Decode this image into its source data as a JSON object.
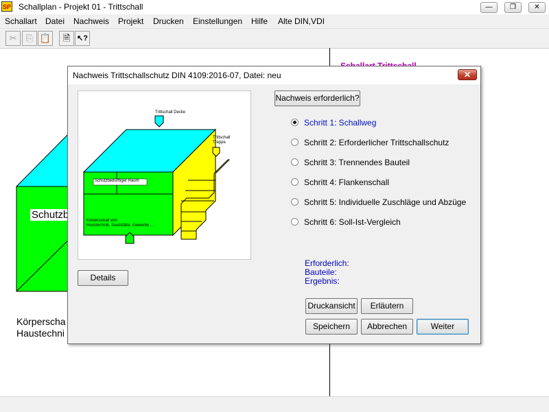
{
  "window": {
    "logo": "SP",
    "title": "Schallplan   - Projekt 01  - Trittschall"
  },
  "window_controls": {
    "minimize": "—",
    "restore": "❐",
    "close": "✕"
  },
  "menu": [
    "Schallart",
    "Datei",
    "Nachweis",
    "Projekt",
    "Drucken",
    "Einstellungen",
    "Hilfe",
    "Alte DIN,VDI"
  ],
  "toolbar": {
    "cut_icon": "✂",
    "copy_icon": "⎘",
    "paste_icon": "📋",
    "properties_icon": "🗎",
    "help_icon": "↖?"
  },
  "background": {
    "room_label": "Schutzb",
    "line1": "Körperscha",
    "line2": "Haustechni",
    "red_heading": "Schallart Trittschall"
  },
  "dialog": {
    "title": "Nachweis Trittschallschutz DIN 4109:2016-07, Datei: neu",
    "close_icon": "✕",
    "diagram": {
      "label_ceiling": "Trittschall Decke",
      "label_stairs_1": "Trittschall",
      "label_stairs_2": "Treppe",
      "label_room": "Schutzbedürftiger Raum",
      "label_body_1": "Körperschall von:",
      "label_body_2": "Haustechnik, Gaststätte, Gewerbe ..."
    },
    "details_button": "Details",
    "check_button": "Nachweis erforderlich?",
    "steps": [
      {
        "label": "Schritt 1: Schallweg",
        "selected": true
      },
      {
        "label": "Schritt 2: Erforderlicher Trittschallschutz",
        "selected": false
      },
      {
        "label": "Schritt 3: Trennendes Bauteil",
        "selected": false
      },
      {
        "label": "Schritt 4: Flankenschall",
        "selected": false
      },
      {
        "label": "Schritt 5: Individuelle Zuschläge und Abzüge",
        "selected": false
      },
      {
        "label": "Schritt 6: Soll-Ist-Vergleich",
        "selected": false
      }
    ],
    "info": {
      "required": "Erforderlich:",
      "parts": "Bauteile:",
      "result": "Ergebnis:"
    },
    "buttons": {
      "print_view": "Druckansicht",
      "explain": "Erläutern",
      "save": "Speichern",
      "cancel": "Abbrechen",
      "next": "Weiter"
    }
  },
  "colors": {
    "ceiling": "#00ffff",
    "room": "#00ff00",
    "stairs": "#ffff00",
    "info_text": "#0000c0",
    "heading": "#b000b0"
  }
}
